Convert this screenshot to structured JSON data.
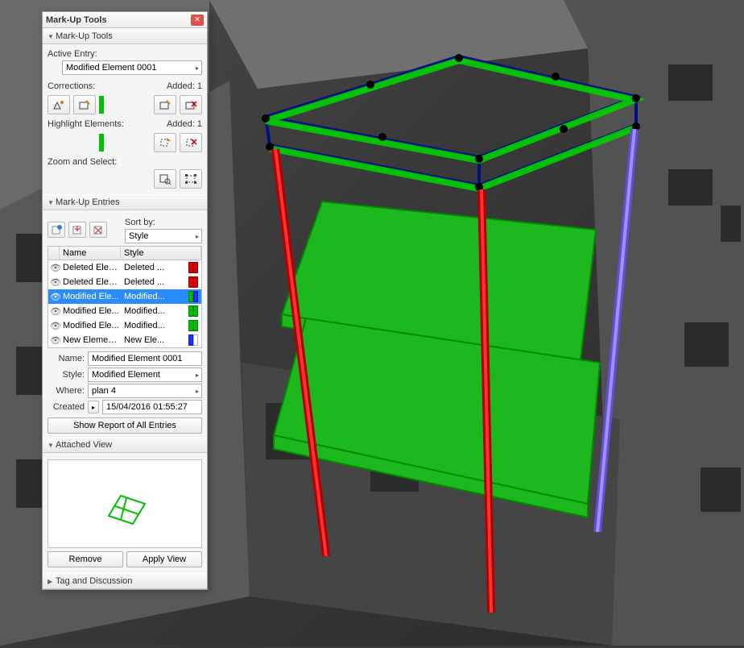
{
  "panel": {
    "title": "Mark-Up Tools",
    "sections": {
      "tools": "Mark-Up Tools",
      "entries": "Mark-Up Entries",
      "view": "Attached View",
      "tag": "Tag and Discussion"
    },
    "active_entry_label": "Active Entry:",
    "active_entry_value": "Modified Element 0001",
    "corrections_label": "Corrections:",
    "added_label_1": "Added: 1",
    "highlight_label": "Highlight Elements:",
    "added_label_2": "Added: 1",
    "zoom_label": "Zoom and Select:",
    "sort_by_label": "Sort by:",
    "sort_by_value": "Style",
    "columns": {
      "name": "Name",
      "style": "Style"
    },
    "rows": [
      {
        "name": "Deleted Elem...",
        "style": "Deleted ...",
        "c1": "#e00000",
        "c2": "#e00000"
      },
      {
        "name": "Deleted Elem...",
        "style": "Deleted ...",
        "c1": "#e00000",
        "c2": "#e00000"
      },
      {
        "name": "Modified Ele...",
        "style": "Modified...",
        "c1": "#00c000",
        "c2": "#2030ff",
        "selected": true
      },
      {
        "name": "Modified Ele...",
        "style": "Modified...",
        "c1": "#00c000",
        "c2": "#00c000"
      },
      {
        "name": "Modified Ele...",
        "style": "Modified...",
        "c1": "#00c000",
        "c2": "#00c000"
      },
      {
        "name": "New Element ...",
        "style": "New Ele...",
        "c1": "#2030ff",
        "c2": "#ffffff"
      }
    ],
    "form": {
      "name_label": "Name:",
      "name_value": "Modified Element 0001",
      "style_label": "Style:",
      "style_value": "Modified Element",
      "where_label": "Where:",
      "where_value": "plan 4",
      "created_label": "Created",
      "created_value": "15/04/2016 01:55:27"
    },
    "report_btn": "Show Report of All Entries",
    "remove_btn": "Remove",
    "apply_btn": "Apply View"
  }
}
